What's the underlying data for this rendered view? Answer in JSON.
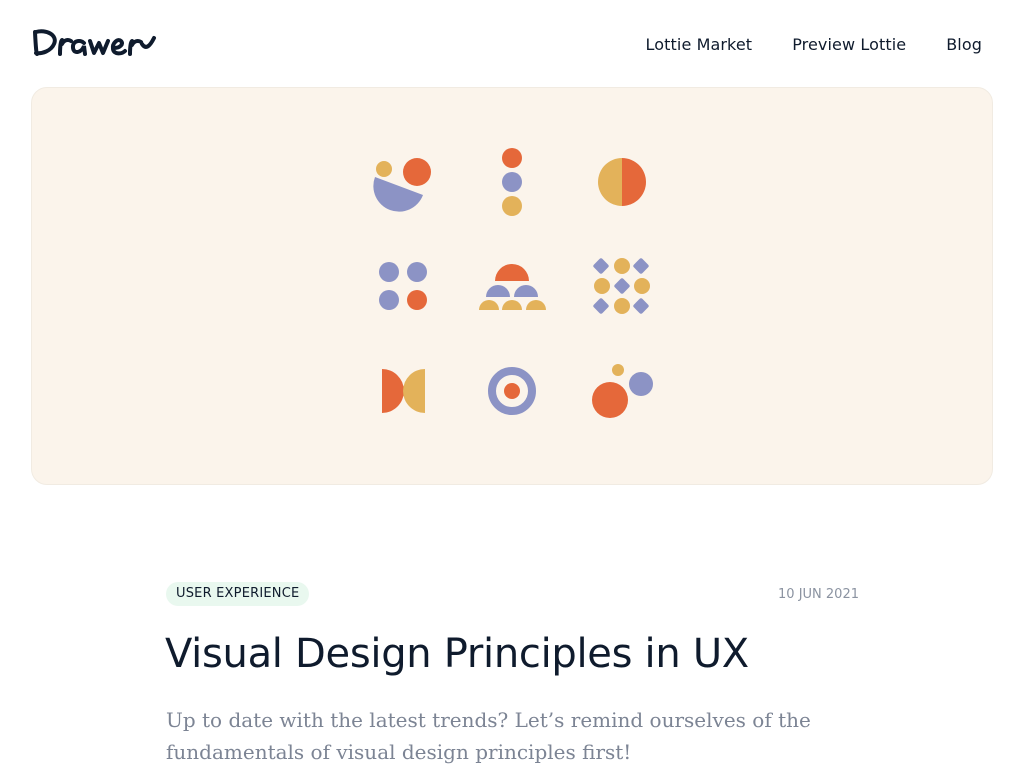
{
  "header": {
    "logo_text": "Drawer",
    "nav": [
      {
        "label": "Lottie Market"
      },
      {
        "label": "Preview Lottie"
      },
      {
        "label": "Blog"
      }
    ]
  },
  "hero": {
    "illustration": "geometric-shapes-grid",
    "colors": {
      "background": "#fbf4eb",
      "orange": "#e5683a",
      "purple": "#8c93c5",
      "yellow": "#e3b25a"
    }
  },
  "article": {
    "category": "USER EXPERIENCE",
    "date": "10 JUN 2021",
    "title": "Visual Design Principles in UX",
    "subtitle": "Up to date with the latest trends? Let’s remind ourselves of the fundamentals of visual design principles first!"
  }
}
